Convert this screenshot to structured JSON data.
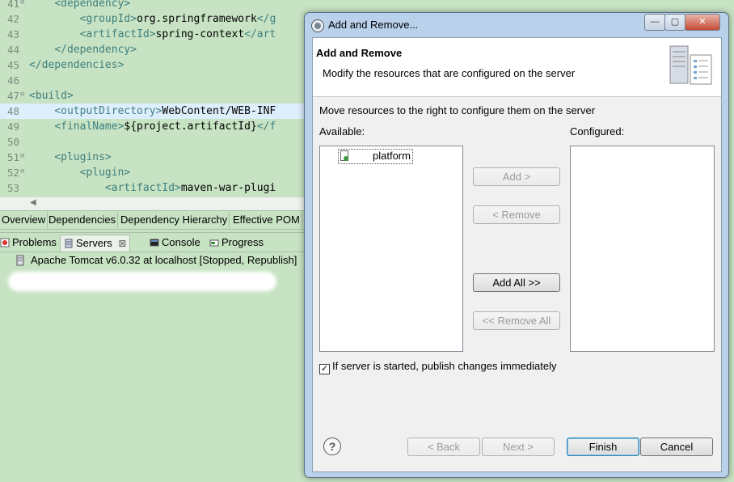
{
  "editor": {
    "lines": [
      {
        "num": "41",
        "fold": "⊖",
        "indent": "    ",
        "open": "<dependency>",
        "text": "",
        "close": ""
      },
      {
        "num": "42",
        "fold": "",
        "indent": "        ",
        "open": "<groupId>",
        "text": "org.springframework",
        "close": "</g"
      },
      {
        "num": "43",
        "fold": "",
        "indent": "        ",
        "open": "<artifactId>",
        "text": "spring-context",
        "close": "</art"
      },
      {
        "num": "44",
        "fold": "",
        "indent": "    ",
        "open": "</dependency>",
        "text": "",
        "close": ""
      },
      {
        "num": "45",
        "fold": "",
        "indent": "",
        "open": "</dependencies>",
        "text": "",
        "close": ""
      },
      {
        "num": "46",
        "fold": "",
        "indent": "",
        "open": "",
        "text": "",
        "close": ""
      },
      {
        "num": "47",
        "fold": "⊖",
        "indent": "",
        "open": "<build>",
        "text": "",
        "close": ""
      },
      {
        "num": "48",
        "fold": "",
        "indent": "    ",
        "open": "<outputDirectory>",
        "text": "WebContent/WEB-INF",
        "close": ""
      },
      {
        "num": "49",
        "fold": "",
        "indent": "    ",
        "open": "<finalName>",
        "text": "${project.artifactId}",
        "close": "</f"
      },
      {
        "num": "50",
        "fold": "",
        "indent": "",
        "open": "",
        "text": "",
        "close": ""
      },
      {
        "num": "51",
        "fold": "⊖",
        "indent": "    ",
        "open": "<plugins>",
        "text": "",
        "close": ""
      },
      {
        "num": "52",
        "fold": "⊖",
        "indent": "        ",
        "open": "<plugin>",
        "text": "",
        "close": ""
      },
      {
        "num": "53",
        "fold": "",
        "indent": "            ",
        "open": "<artifactId>",
        "text": "maven-war-plugi",
        "close": ""
      }
    ]
  },
  "pom_tabs": [
    "Overview",
    "Dependencies",
    "Dependency Hierarchy",
    "Effective POM"
  ],
  "view_tabs": {
    "problems": "Problems",
    "servers": "Servers",
    "servers_close": "⊠",
    "console": "Console",
    "progress": "Progress"
  },
  "servers": {
    "row": "Apache Tomcat v6.0.32 at localhost  [Stopped, Republish]"
  },
  "dialog": {
    "title": "Add and Remove...",
    "window_buttons": {
      "minimize": "—",
      "maximize": "▢",
      "close": "✕"
    },
    "header_title": "Add and Remove",
    "header_desc": "Modify the resources that are configured on the server",
    "instruction": "Move resources to the right to configure them on the server",
    "available_label": "Available:",
    "configured_label": "Configured:",
    "available_items": [
      {
        "label": "platform"
      }
    ],
    "buttons": {
      "add": "Add >",
      "remove": "< Remove",
      "add_all": "Add All >>",
      "remove_all": "<< Remove All",
      "back": "< Back",
      "next": "Next >",
      "finish": "Finish",
      "cancel": "Cancel"
    },
    "publish_checkbox": {
      "label": "If server is started, publish changes immediately",
      "checked": true,
      "mark": "✓"
    },
    "help": "?"
  },
  "colors": {
    "editor_bg": "#c7e3c3",
    "tag": "#3f7f7f",
    "dialog_frame": "#b9d1ea"
  }
}
